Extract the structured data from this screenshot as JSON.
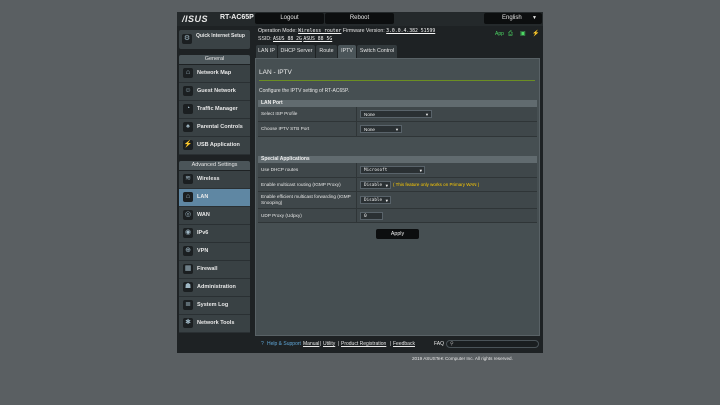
{
  "header": {
    "logo": "/ISUS",
    "model": "RT-AC65P",
    "logout": "Logout",
    "reboot": "Reboot",
    "language": "English",
    "operation_mode_label": "Operation Mode:",
    "operation_mode_value": "Wireless router",
    "firmware_label": "Firmware Version:",
    "firmware_value": "3.0.0.4.382_51599",
    "ssid_label": "SSID:",
    "ssid_1": "ASUS_88_2G",
    "ssid_2": "ASUS_88_5G",
    "app_label": "App"
  },
  "sidebar": {
    "quick_setup": "Quick Internet Setup",
    "general_title": "General",
    "general": [
      {
        "label": "Network Map",
        "icon": "network-map-icon"
      },
      {
        "label": "Guest Network",
        "icon": "guest-network-icon"
      },
      {
        "label": "Traffic Manager",
        "icon": "traffic-manager-icon"
      },
      {
        "label": "Parental Controls",
        "icon": "parental-controls-icon"
      },
      {
        "label": "USB Application",
        "icon": "usb-icon"
      }
    ],
    "advanced_title": "Advanced Settings",
    "advanced": [
      {
        "label": "Wireless",
        "icon": "wireless-icon"
      },
      {
        "label": "LAN",
        "icon": "lan-icon"
      },
      {
        "label": "WAN",
        "icon": "wan-icon"
      },
      {
        "label": "IPv6",
        "icon": "ipv6-icon"
      },
      {
        "label": "VPN",
        "icon": "vpn-icon"
      },
      {
        "label": "Firewall",
        "icon": "firewall-icon"
      },
      {
        "label": "Administration",
        "icon": "administration-icon"
      },
      {
        "label": "System Log",
        "icon": "system-log-icon"
      },
      {
        "label": "Network Tools",
        "icon": "network-tools-icon"
      }
    ],
    "active": "LAN"
  },
  "tabs": [
    "LAN IP",
    "DHCP Server",
    "Route",
    "IPTV",
    "Switch Control"
  ],
  "active_tab": "IPTV",
  "content": {
    "title": "LAN - IPTV",
    "description": "Configure the IPTV setting of RT-AC65P.",
    "lan_port": {
      "title": "LAN Port",
      "isp_profile_label": "Select ISP Profile",
      "isp_profile_value": "None",
      "stb_port_label": "Choose IPTV STB Port",
      "stb_port_value": "None"
    },
    "special": {
      "title": "Special Applications",
      "dhcp_routes_label": "Use DHCP routes",
      "dhcp_routes_value": "Microsoft",
      "multicast_label": "Enable multicast routing (IGMP Proxy)",
      "multicast_value": "Disable",
      "multicast_note": "( This feature only works on Primary WAN )",
      "efficient_label_1": "Enable efficient multicast forwarding (IGMP",
      "efficient_label_2": "Snooping)",
      "efficient_value": "Disable",
      "udp_proxy_label": "UDP Proxy (Udpxy)",
      "udp_proxy_value": "0"
    },
    "apply": "Apply"
  },
  "footer": {
    "help": "Help & Support",
    "manual": "Manual",
    "utility": "Utility",
    "product_registration": "Product Registration",
    "feedback": "Feedback",
    "faq": "FAQ",
    "copyright": "2019 ASUSTeK Computer Inc. All rights reserved."
  },
  "colors": {
    "accent_active": "#5f87a3",
    "status_green": "#4cd964",
    "note_yellow": "#ffcc00"
  }
}
